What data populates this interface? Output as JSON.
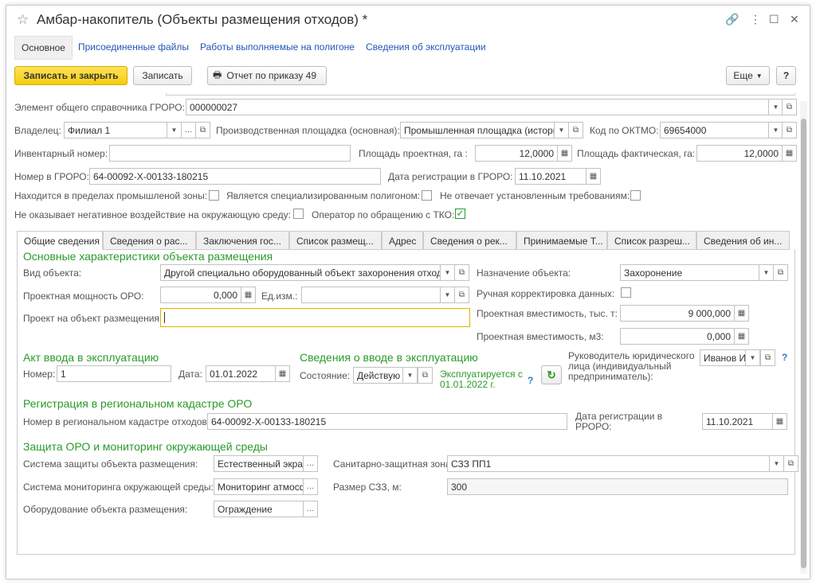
{
  "window": {
    "title": "Амбар-накопитель (Объекты размещения отходов) *"
  },
  "nav": {
    "main": "Основное",
    "files": "Присоединенные файлы",
    "works": "Работы выполняемые на полигоне",
    "exploitation": "Сведения об эксплуатации"
  },
  "toolbar": {
    "save_close": "Записать и закрыть",
    "save": "Записать",
    "report": "Отчет по приказу 49",
    "more": "Еще",
    "help": "?"
  },
  "fields": {
    "ref_label": "Элемент общего справочника ГРОРО:",
    "ref_value": "000000027",
    "owner_label": "Владелец:",
    "owner_value": "Филиал 1",
    "site_label": "Производственная площадка (основная):",
    "site_value": "Промышленная площадка (истори",
    "oktmo_label": "Код по ОКТМО:",
    "oktmo_value": "69654000",
    "inv_label": "Инвентарный номер:",
    "inv_value": "",
    "area_proj_label": "Площадь проектная, га :",
    "area_proj_value": "12,0000",
    "area_fact_label": "Площадь фактическая, га:",
    "area_fact_value": "12,0000",
    "groro_label": "Номер в ГРОРО:",
    "groro_value": "64-00092-Х-00133-180215",
    "reg_date_label": "Дата регистрации в ГРОРО:",
    "reg_date_value": "11.10.2021",
    "prom_zone_label": "Находится в пределах промышленой зоны:",
    "special_label": "Является специализированным полигоном:",
    "req_label": "Не отвечает установленным требованиям:",
    "neg_label": "Не оказывает негативное воздействие на окружающую среду:",
    "tko_label": "Оператор по обращению с ТКО:"
  },
  "tabs": [
    "Общие сведения",
    "Сведения о рас...",
    "Заключения гос...",
    "Список размещ...",
    "Адрес",
    "Сведения о рек...",
    "Принимаемые Т...",
    "Список разреш...",
    "Сведения об ин..."
  ],
  "general": {
    "sec_main": "Основные характеристики объекта размещения",
    "kind_label": "Вид объекта:",
    "kind_value": "Другой специально оборудованный объект захоронения отходо",
    "purpose_label": "Назначение объекта:",
    "purpose_value": "Захоронение",
    "power_label": "Проектная мощность ОРО:",
    "power_value": "0,000",
    "unit_label": "Ед.изм.:",
    "unit_value": "",
    "manual_label": "Ручная корректировка данных:",
    "project_label": "Проект на объект размещения:",
    "project_value": "",
    "cap_t_label": "Проектная вместимость, тыс. т:",
    "cap_t_value": "9 000,000",
    "cap_m3_label": "Проектная вместимость, м3:",
    "cap_m3_value": "0,000",
    "sec_act": "Акт ввода в эксплуатацию",
    "num_label": "Номер:",
    "num_value": "1",
    "date_label": "Дата:",
    "date_value": "01.01.2022",
    "sec_input": "Сведения о вводе в эксплуатацию",
    "state_label": "Состояние:",
    "state_value": "Действую",
    "state_text": "Эксплуатируется с 01.01.2022 г.",
    "head_label": "Руководитель юридического лица (индивидуальный предприниматель):",
    "head_value": "Иванов Ив",
    "sec_reg": "Регистрация в региональном кадастре ОРО",
    "kad_label": "Номер в региональном кадастре отходов:",
    "kad_value": "64-00092-Х-00133-180215",
    "rroro_label": "Дата регистрации в РРОРО:",
    "rroro_value": "11.10.2021",
    "sec_prot": "Защита ОРО и мониторинг окружающей среды",
    "prot_label": "Система защиты объекта размещения:",
    "prot_value": "Естественный экра",
    "szz_label": "Санитарно-защитная зона:",
    "szz_value": "СЗЗ ПП1",
    "mon_label": "Система мониторинга окружающей среды:",
    "mon_value": "Мониторинг атмосф",
    "szz_size_label": "Размер СЗЗ, м:",
    "szz_size_value": "300",
    "equip_label": "Оборудование объекта размещения:",
    "equip_value": "Ограждение"
  },
  "colors": {
    "accent": "#f5cd0c",
    "section": "#2a9a2a",
    "link": "#2257b5"
  }
}
